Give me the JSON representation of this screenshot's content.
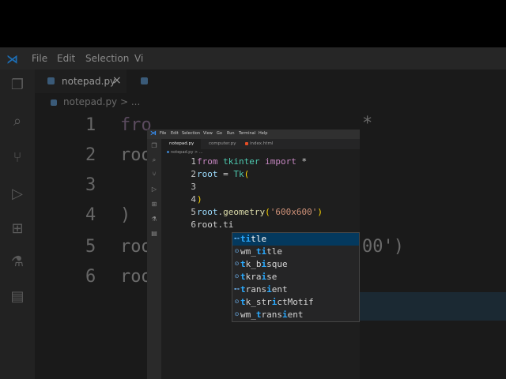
{
  "background": {
    "menu": [
      "File",
      "Edit",
      "Selection",
      "Vi"
    ],
    "tab_label": "notepad.py",
    "breadcrumb": "notepad.py > ...",
    "line_numbers": [
      "1",
      "2",
      "3",
      "4",
      "5",
      "6"
    ],
    "code_fragments": [
      "fro",
      "roo",
      ")",
      "roo",
      "roo"
    ],
    "right_fragments": [
      "*",
      "00')"
    ]
  },
  "window": {
    "menu": [
      "File",
      "Edit",
      "Selection",
      "View",
      "Go",
      "Run",
      "Terminal",
      "Help"
    ],
    "tabs": [
      {
        "label": "notepad.py",
        "color": "#3a78b8",
        "active": true
      },
      {
        "label": "computer.py",
        "color": "#3a78b8",
        "active": false
      },
      {
        "label": "index.html",
        "color": "#e44d26",
        "active": false
      }
    ],
    "breadcrumb": "notepad.py > ...",
    "line_numbers": [
      "1",
      "2",
      "3",
      "4",
      "5",
      "6"
    ],
    "code": {
      "l1_from": "from",
      "l1_module": "tkinter",
      "l1_import": "import",
      "l1_star": "*",
      "l2_var": "root",
      "l2_eq": "=",
      "l2_call": "Tk",
      "l2_paren": "(",
      "l4_paren": ")",
      "l5_var": "root",
      "l5_dot": ".",
      "l5_method": "geometry",
      "l5_open": "(",
      "l5_str": "'600x600'",
      "l5_close": ")",
      "l6_text": "root.ti"
    },
    "suggestions": [
      {
        "pre": "",
        "match": "ti",
        "post": "tle",
        "icon": "method-icon",
        "selected": true
      },
      {
        "pre": "wm_",
        "match": "ti",
        "post": "tle",
        "icon": "method-icon",
        "selected": false
      },
      {
        "pre": "",
        "match": "t",
        "post": "k_b",
        "match2": "i",
        "post2": "sque",
        "icon": "field-icon",
        "selected": false
      },
      {
        "pre": "",
        "match": "t",
        "post": "kra",
        "match2": "i",
        "post2": "se",
        "icon": "field-icon",
        "selected": false
      },
      {
        "pre": "",
        "match": "t",
        "post": "rans",
        "match2": "i",
        "post2": "ent",
        "icon": "method-icon",
        "selected": false
      },
      {
        "pre": "",
        "match": "t",
        "post": "k_str",
        "match2": "i",
        "post2": "ctMotif",
        "icon": "field-icon",
        "selected": false
      },
      {
        "pre": "wm_",
        "match": "t",
        "post": "rans",
        "match2": "i",
        "post2": "ent",
        "icon": "field-icon",
        "selected": false
      }
    ]
  },
  "colors": {
    "accent": "#04395e",
    "match": "#2aaaff",
    "keyword": "#c586c0",
    "string": "#ce9178"
  }
}
